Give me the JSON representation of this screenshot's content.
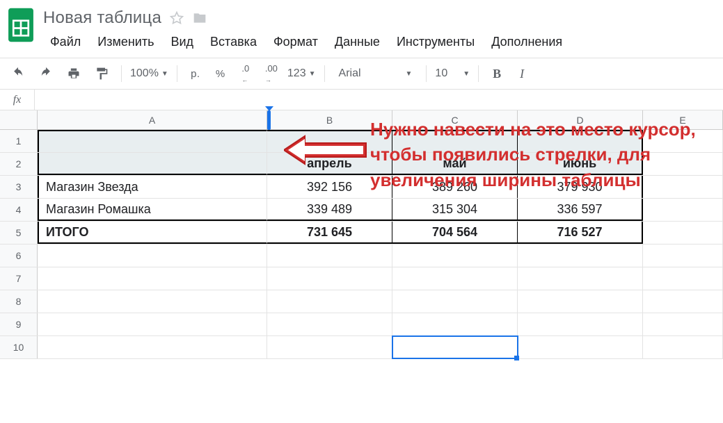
{
  "doc": {
    "title": "Новая таблица"
  },
  "menu": {
    "file": "Файл",
    "edit": "Изменить",
    "view": "Вид",
    "insert": "Вставка",
    "format": "Формат",
    "data": "Данные",
    "tools": "Инструменты",
    "addons": "Дополнения"
  },
  "toolbar": {
    "zoom": "100%",
    "currency": "р.",
    "percent": "%",
    "dec_less": ".0",
    "dec_more": ".00",
    "numfmt": "123",
    "font": "Arial",
    "size": "10",
    "bold": "B",
    "italic": "I"
  },
  "fx": {
    "label": "fx"
  },
  "columns": {
    "A": "A",
    "B": "B",
    "C": "C",
    "D": "D",
    "E": "E"
  },
  "rownums": [
    "1",
    "2",
    "3",
    "4",
    "5",
    "6",
    "7",
    "8",
    "9",
    "10"
  ],
  "sheet": {
    "headers": {
      "b": "апрель",
      "c": "май",
      "d": "июнь"
    },
    "rows": [
      {
        "a": "Магазин Звезда",
        "b": "392 156",
        "c": "389 260",
        "d": "379 930"
      },
      {
        "a": "Магазин Ромашка",
        "b": "339 489",
        "c": "315 304",
        "d": "336 597"
      }
    ],
    "total": {
      "a": "ИТОГО",
      "b": "731 645",
      "c": "704 564",
      "d": "716 527"
    }
  },
  "annotation": "Нужно навести на это место курсор, чтобы появились стрелки, для увеличения ширины таблицы",
  "colors": {
    "accent": "#1a73e8",
    "annot": "#d32f2f",
    "sheets_green": "#0f9d58"
  }
}
